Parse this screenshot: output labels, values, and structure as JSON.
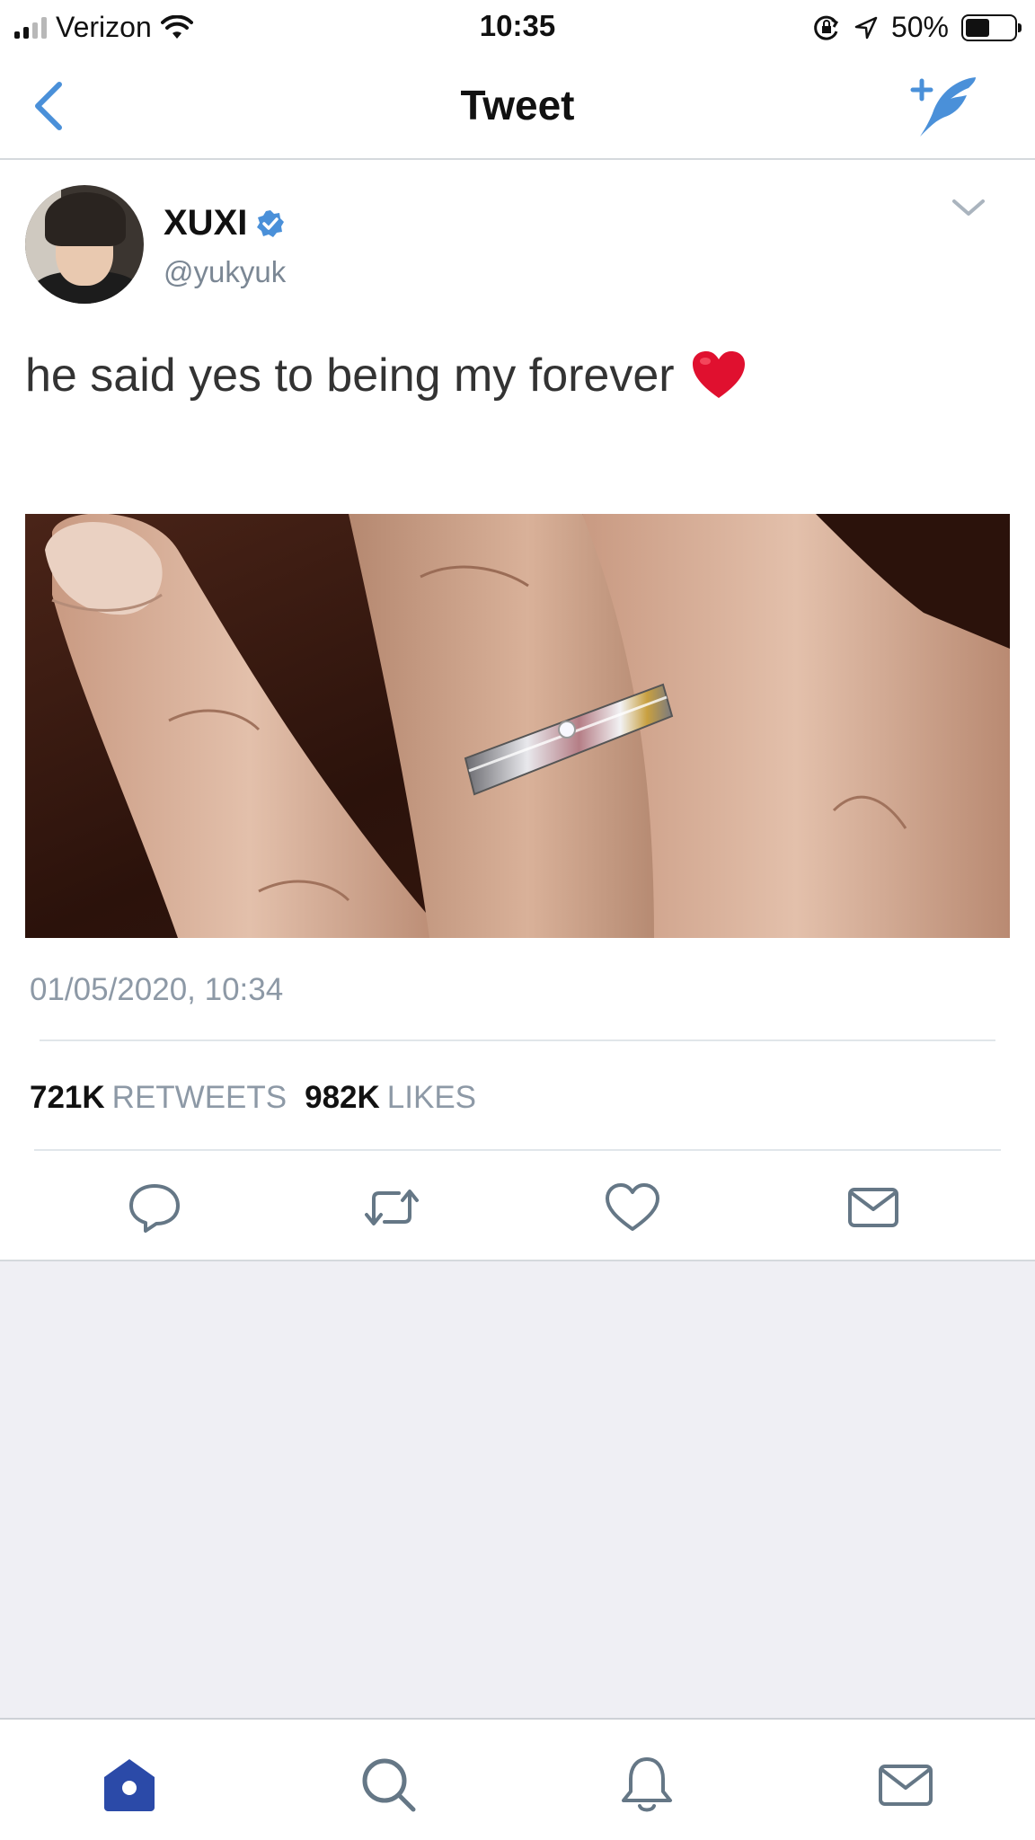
{
  "status_bar": {
    "carrier": "Verizon",
    "time": "10:35",
    "battery_percent": "50%",
    "battery_level": 0.5,
    "icons": [
      "signal-icon",
      "wifi-icon",
      "orientation-lock-icon",
      "location-icon",
      "battery-icon"
    ]
  },
  "nav": {
    "title": "Tweet",
    "back_icon": "chevron-left-icon",
    "compose_icon": "compose-tweet-icon"
  },
  "tweet": {
    "author_name": "XUXI",
    "author_handle": "@yukyuk",
    "verified": true,
    "text": "he said yes to being my forever",
    "emoji": "red-heart",
    "timestamp": "01/05/2020, 10:34",
    "image_alt": "hand with ring"
  },
  "stats": {
    "retweets_count": "721K",
    "retweets_label": "RETWEETS",
    "likes_count": "982K",
    "likes_label": "LIKES"
  },
  "actions": [
    "reply-icon",
    "retweet-icon",
    "like-icon",
    "direct-message-icon"
  ],
  "tab_bar": {
    "items": [
      "home-icon",
      "search-icon",
      "notifications-icon",
      "messages-icon"
    ],
    "active": "home-icon"
  },
  "colors": {
    "accent": "#4a90d9",
    "tab_active": "#2b4aa8",
    "muted_text": "#8d99a6",
    "empty_bg": "#efeff4",
    "heart_red": "#e0102f"
  }
}
